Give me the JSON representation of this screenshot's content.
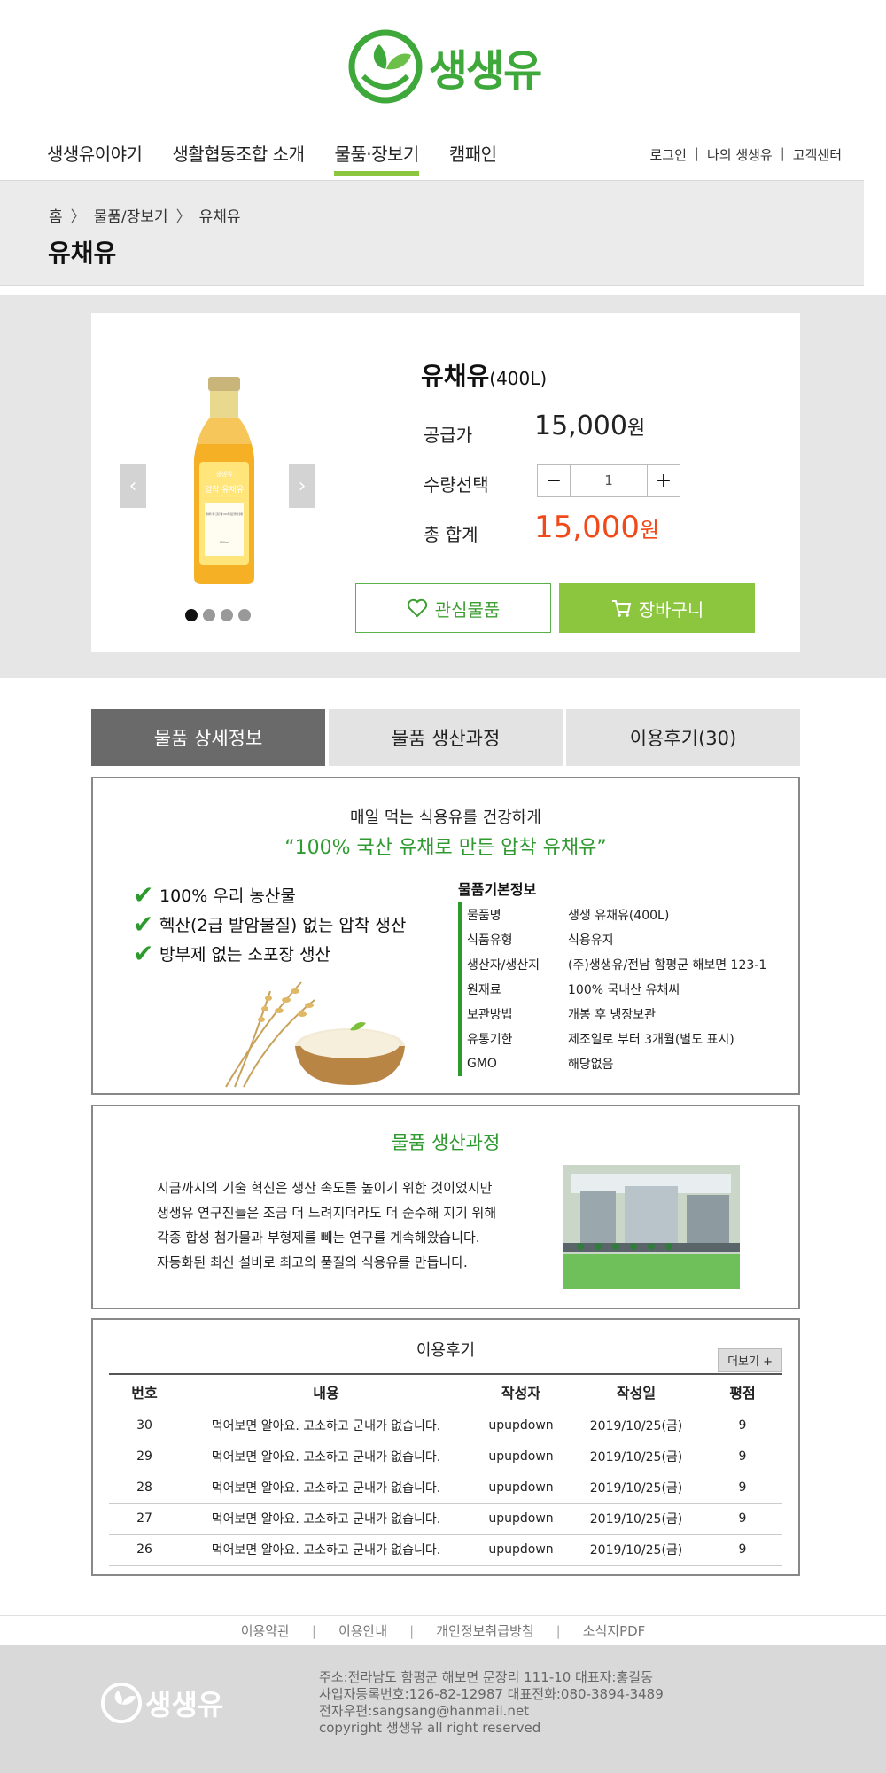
{
  "brand": {
    "name": "생생유",
    "accent": "#8cc63e",
    "green": "#2f9a2f"
  },
  "nav": {
    "items": [
      "생생유이야기",
      "생활협동조합 소개",
      "물품·장보기",
      "캠패인"
    ],
    "active_index": 2
  },
  "util": {
    "login": "로그인",
    "my": "나의 생생유",
    "support": "고객센터",
    "sep": "|"
  },
  "breadcrumb": {
    "home": "홈",
    "category": "물품/장보기",
    "current": "유채유",
    "sep": "〉"
  },
  "page_title": "유채유",
  "product": {
    "name": "유채유",
    "volume": "(400L)",
    "price_label": "공급가",
    "price": "15,000",
    "won": "원",
    "qty_label": "수량선택",
    "qty": "1",
    "qty_minus": "−",
    "qty_plus": "+",
    "total_label": "총 합계",
    "total": "15,000",
    "like_button": "관심물품",
    "cart_button": "장바구니",
    "prev": "‹",
    "next": "›",
    "slide_count": 4,
    "slide_active": 1,
    "bottle_label": {
      "brand": "생생유",
      "title": "압착 유채유",
      "desc": "\"생생하게, 깨끗, 드러운 기름\" 100%국산 원료 압착생산 유채유",
      "volume": "400ml"
    }
  },
  "tabs": {
    "items": [
      "물품 상세정보",
      "물품 생산과정",
      "이용후기(30)"
    ],
    "active_index": 0
  },
  "detail": {
    "headline": "매일 먹는 식용유를 건강하게",
    "subhead": "“100% 국산 유채로 만든 압착 유채유”",
    "tick": "✔",
    "checks": [
      "100% 우리 농산물",
      "헥산(2급 발암물질) 없는 압착 생산",
      "방부제 없는 소포장 생산"
    ],
    "info_title": "물품기본정보",
    "info": [
      {
        "k": "물품명",
        "v": "생생 유채유(400L)"
      },
      {
        "k": "식품유형",
        "v": "식용유지"
      },
      {
        "k": "생산자/생산지",
        "v": "(주)생생유/전남 함평군 해보면 123-1"
      },
      {
        "k": "원재료",
        "v": "100% 국내산 유채씨"
      },
      {
        "k": "보관방법",
        "v": "개봉 후 냉장보관"
      },
      {
        "k": "유통기한",
        "v": "제조일로 부터 3개월(별도 표시)"
      },
      {
        "k": "GMO",
        "v": "해당없음"
      }
    ]
  },
  "process": {
    "title": "물품 생산과정",
    "lines": [
      "지금까지의 기술 혁신은 생산 속도를 높이기 위한 것이었지만",
      "생생유 연구진들은 조금 더 느려지더라도 더 순수해 지기 위해",
      "각종 합성 첨가물과 부형제를 빼는 연구를 계속해왔습니다.",
      "자동화된 최신 설비로 최고의 품질의 식용유를 만듭니다."
    ]
  },
  "reviews": {
    "title": "이용후기",
    "more": "더보기 +",
    "headers": [
      "번호",
      "내용",
      "작성자",
      "작성일",
      "평점"
    ],
    "rows": [
      [
        "30",
        "먹어보면 알아요. 고소하고 군내가 없습니다.",
        "upupdown",
        "2019/10/25(금)",
        "9"
      ],
      [
        "29",
        "먹어보면 알아요. 고소하고 군내가 없습니다.",
        "upupdown",
        "2019/10/25(금)",
        "9"
      ],
      [
        "28",
        "먹어보면 알아요. 고소하고 군내가 없습니다.",
        "upupdown",
        "2019/10/25(금)",
        "9"
      ],
      [
        "27",
        "먹어보면 알아요. 고소하고 군내가 없습니다.",
        "upupdown",
        "2019/10/25(금)",
        "9"
      ],
      [
        "26",
        "먹어보면 알아요. 고소하고 군내가 없습니다.",
        "upupdown",
        "2019/10/25(금)",
        "9"
      ]
    ]
  },
  "footer": {
    "links": [
      "이용약관",
      "이용안내",
      "개인정보취급방침",
      "소식지PDF"
    ],
    "sep": "|",
    "lines": [
      "주소:전라남도 함평군 해보면 문장리 111-10 대표자:홍길동",
      "사업자등록번호:126-82-12987 대표전화:080-3894-3489",
      "전자우편:sangsang@hanmail.net",
      "copyright 생생유 all right reserved"
    ]
  }
}
